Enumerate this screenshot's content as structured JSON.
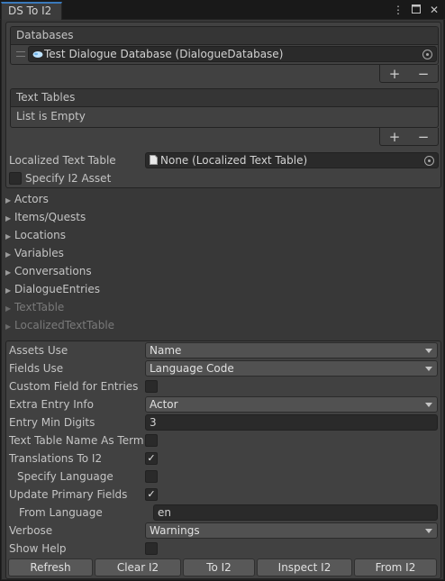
{
  "window": {
    "tab_title": "DS To I2",
    "menu_icon": "kebab-menu-icon",
    "maximize_icon": "maximize-icon",
    "close_icon": "close-icon"
  },
  "databases": {
    "header": "Databases",
    "items": [
      {
        "icon": "dialogue-database-icon",
        "value": "Test Dialogue Database (DialogueDatabase)"
      }
    ],
    "add_label": "+",
    "remove_label": "−"
  },
  "text_tables": {
    "header": "Text Tables",
    "empty_text": "List is Empty",
    "add_label": "+",
    "remove_label": "−"
  },
  "localized_text_table": {
    "label": "Localized Text Table",
    "icon": "document-icon",
    "value": "None (Localized Text Table)"
  },
  "specify_i2_asset": {
    "label": "Specify I2 Asset",
    "checked": false
  },
  "foldouts": [
    {
      "label": "Actors",
      "enabled": true
    },
    {
      "label": "Items/Quests",
      "enabled": true
    },
    {
      "label": "Locations",
      "enabled": true
    },
    {
      "label": "Variables",
      "enabled": true
    },
    {
      "label": "Conversations",
      "enabled": true
    },
    {
      "label": "DialogueEntries",
      "enabled": true
    },
    {
      "label": "TextTable",
      "enabled": false
    },
    {
      "label": "LocalizedTextTable",
      "enabled": false
    }
  ],
  "settings": {
    "assets_use": {
      "label": "Assets Use",
      "value": "Name"
    },
    "fields_use": {
      "label": "Fields Use",
      "value": "Language Code"
    },
    "custom_field_for_entries": {
      "label": "Custom Field for Entries",
      "checked": false
    },
    "extra_entry_info": {
      "label": "Extra Entry Info",
      "value": "Actor"
    },
    "entry_min_digits": {
      "label": "Entry Min Digits",
      "value": "3"
    },
    "text_table_name_as_term": {
      "label": "Text Table Name As Term",
      "checked": false
    },
    "translations_to_i2": {
      "label": "Translations To I2",
      "checked": true,
      "check_glyph": "✓"
    },
    "specify_language": {
      "label": "Specify Language",
      "checked": false
    },
    "update_primary_fields": {
      "label": "Update Primary Fields",
      "checked": true,
      "check_glyph": "✓"
    },
    "from_language": {
      "label": "From Language",
      "value": "en"
    },
    "verbose": {
      "label": "Verbose",
      "value": "Warnings"
    },
    "show_help": {
      "label": "Show Help",
      "checked": false
    }
  },
  "buttons": {
    "refresh": "Refresh",
    "clear_i2": "Clear I2",
    "to_i2": "To I2",
    "inspect_i2": "Inspect I2",
    "from_i2": "From I2"
  },
  "colors": {
    "tab_accent": "#3a79bb",
    "panel_bg": "#383838",
    "field_bg": "#2a2a2a"
  }
}
